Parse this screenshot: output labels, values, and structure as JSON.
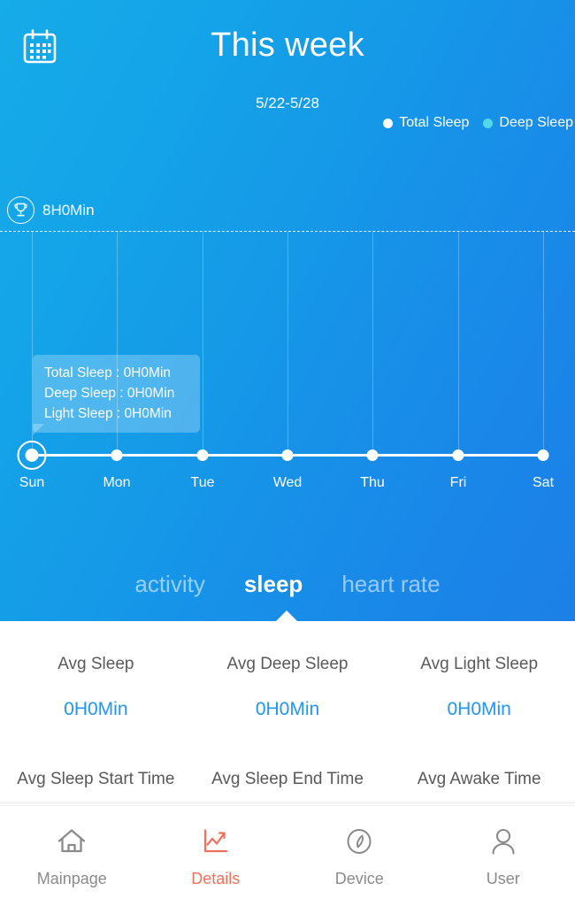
{
  "header": {
    "calendar_icon": "calendar-icon",
    "title": "This week",
    "date_range": "5/22-5/28"
  },
  "legend": {
    "items": [
      {
        "label": "Total Sleep",
        "color": "#FFFFFF",
        "icon": "legend-dot-icon"
      },
      {
        "label": "Deep Sleep",
        "color": "#4FD8E8",
        "icon": "legend-dot-icon"
      }
    ]
  },
  "goal": {
    "icon": "trophy-icon",
    "label": "8H0Min"
  },
  "tooltip": {
    "rows": [
      "Total Sleep : 0H0Min",
      "Deep Sleep : 0H0Min",
      "Light Sleep : 0H0Min"
    ]
  },
  "tabs": {
    "items": [
      {
        "label": "activity",
        "active": false
      },
      {
        "label": "sleep",
        "active": true
      },
      {
        "label": "heart rate",
        "active": false
      }
    ]
  },
  "stats": {
    "row1": [
      {
        "label": "Avg Sleep",
        "value": "0H0Min"
      },
      {
        "label": "Avg Deep Sleep",
        "value": "0H0Min"
      },
      {
        "label": "Avg Light Sleep",
        "value": "0H0Min"
      }
    ],
    "row2": [
      {
        "label": "Avg Sleep Start Time"
      },
      {
        "label": "Avg Sleep End Time"
      },
      {
        "label": "Avg Awake Time"
      }
    ]
  },
  "bottom_nav": {
    "items": [
      {
        "label": "Mainpage",
        "icon": "home-icon",
        "active": false
      },
      {
        "label": "Details",
        "icon": "line-chart-icon",
        "active": true
      },
      {
        "label": "Device",
        "icon": "compass-icon",
        "active": false
      },
      {
        "label": "User",
        "icon": "person-icon",
        "active": false
      }
    ],
    "active_color": "#F2705A",
    "inactive_color": "#8A8A8A"
  },
  "chart_data": {
    "type": "line",
    "title": "This week",
    "subtitle": "5/22-5/28",
    "categories": [
      "Sun",
      "Mon",
      "Tue",
      "Wed",
      "Thu",
      "Fri",
      "Sat"
    ],
    "series": [
      {
        "name": "Total Sleep",
        "values": [
          0,
          0,
          0,
          0,
          0,
          0,
          0
        ],
        "color": "#FFFFFF"
      },
      {
        "name": "Deep Sleep",
        "values": [
          0,
          0,
          0,
          0,
          0,
          0,
          0
        ],
        "color": "#4FD8E8"
      }
    ],
    "goal_line": {
      "label": "8H0Min",
      "value": 480,
      "style": "dashed"
    },
    "ylabel": "",
    "xlabel": "",
    "ylim": [
      0,
      480
    ],
    "grid": "vertical",
    "legend_position": "top-right",
    "selected_index": 0,
    "units": "minutes"
  }
}
